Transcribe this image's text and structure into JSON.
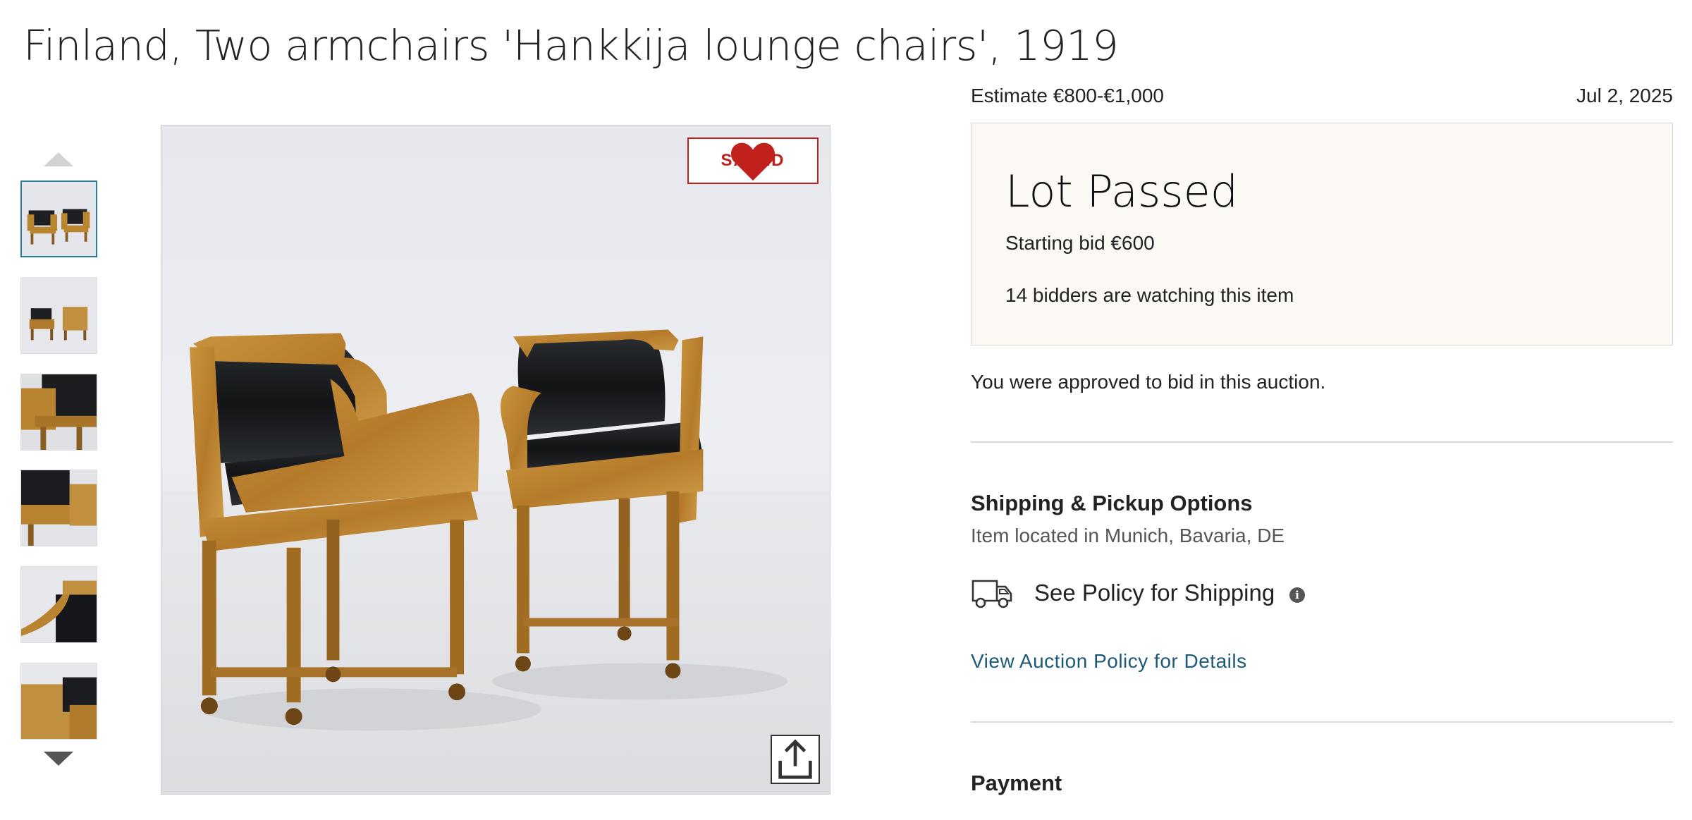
{
  "lot": {
    "title": "Finland, Two armchairs 'Hankkija lounge chairs', 1919",
    "estimate": "Estimate €800-€1,000",
    "date": "Jul 2, 2025"
  },
  "gallery": {
    "saved_label": "SAVED",
    "thumbnail_count": 6,
    "active_thumbnail": 1,
    "icons": {
      "up": "chevron-up-icon",
      "down": "chevron-down-icon",
      "saved": "heart-icon",
      "share": "share-icon"
    }
  },
  "status": {
    "title": "Lot Passed",
    "starting_bid": "Starting bid €600",
    "watchers": "14 bidders are watching this item"
  },
  "approval": {
    "text": "You were approved to bid in this auction."
  },
  "shipping": {
    "heading": "Shipping & Pickup Options",
    "location": "Item located in Munich, Bavaria, DE",
    "policy_label": "See Policy for Shipping",
    "info_glyph": "i",
    "auction_policy_link": "View Auction Policy for Details"
  },
  "payment": {
    "heading": "Payment"
  },
  "colors": {
    "saved_red": "#c0211d",
    "link_blue": "#1d5a78",
    "status_bg": "#fcf8f4",
    "active_thumb_border": "#2a7f96"
  }
}
